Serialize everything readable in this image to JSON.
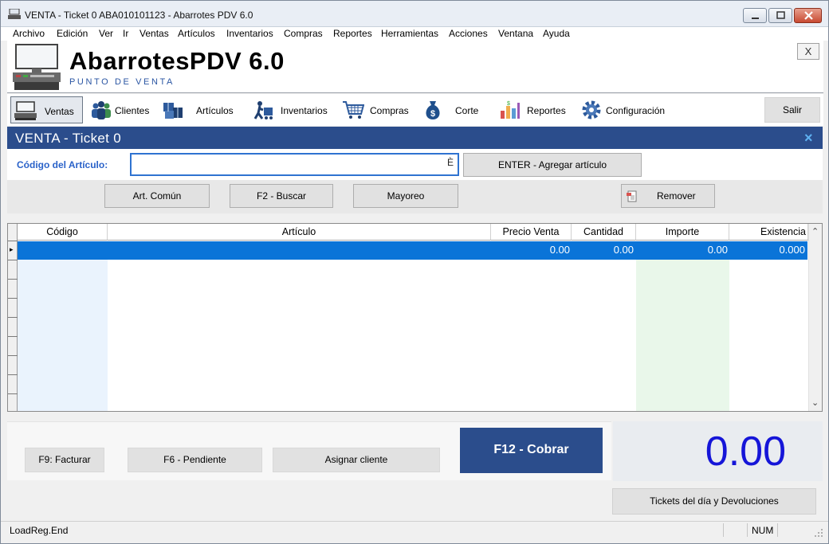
{
  "window": {
    "title": "VENTA - Ticket 0 ABA010101123 - Abarrotes PDV 6.0"
  },
  "menu": {
    "items": [
      "Archivo",
      "Edición",
      "Ver",
      "Ir",
      "Ventas",
      "Artículos",
      "Inventarios",
      "Compras",
      "Reportes",
      "Herramientas",
      "Acciones",
      "Ventana",
      "Ayuda"
    ]
  },
  "header": {
    "title": "AbarrotesPDV 6.0",
    "subtitle": "PUNTO DE VENTA",
    "close_label": "X"
  },
  "toolbar": {
    "items": [
      {
        "label": "Ventas",
        "icon": "register-icon"
      },
      {
        "label": "Clientes",
        "icon": "people-icon"
      },
      {
        "label": "Artículos",
        "icon": "boxes-icon"
      },
      {
        "label": "Inventarios",
        "icon": "handcart-icon"
      },
      {
        "label": "Compras",
        "icon": "cart-icon"
      },
      {
        "label": "Corte",
        "icon": "money-bag-icon"
      },
      {
        "label": "Reportes",
        "icon": "bar-chart-icon"
      },
      {
        "label": "Configuración",
        "icon": "gear-icon"
      }
    ],
    "salir_label": "Salir"
  },
  "panel": {
    "title": "VENTA - Ticket 0",
    "close_glyph": "×"
  },
  "code_entry": {
    "label": "Código del Artículo:",
    "value": "",
    "glyph": "È",
    "enter_label": "ENTER - Agregar artículo"
  },
  "actions": {
    "art_comun": "Art. Común",
    "buscar": "F2 - Buscar",
    "mayoreo": "Mayoreo",
    "remover": "Remover"
  },
  "grid": {
    "columns": [
      "Código",
      "Artículo",
      "Precio Venta",
      "Cantidad",
      "Importe",
      "Existencia"
    ],
    "rows": [
      {
        "codigo": "",
        "articulo": "",
        "precio": "0.00",
        "cantidad": "0.00",
        "importe": "0.00",
        "existencia": "0.000"
      }
    ],
    "row_marker": "▸"
  },
  "footer": {
    "facturar": "F9:   Facturar",
    "pendiente": "F6 - Pendiente",
    "asignar": "Asignar cliente",
    "cobrar": "F12 - Cobrar",
    "total": "0.00",
    "tickets": "Tickets del día y Devoluciones"
  },
  "status": {
    "text": "LoadReg.End",
    "num": "NUM"
  },
  "colors": {
    "accent": "#2b4d8c",
    "selection": "#0a74d8",
    "total": "#1515d8",
    "label": "#2a62c9"
  }
}
